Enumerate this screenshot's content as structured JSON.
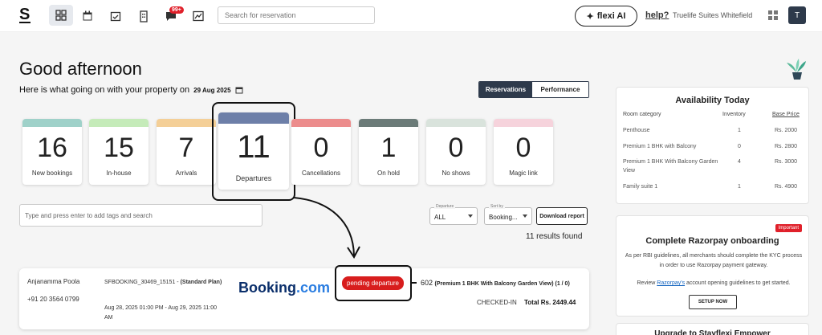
{
  "nav": {
    "logo": "S",
    "search_placeholder": "Search for reservation",
    "notification_count": "99+",
    "flexi_label": "flexi AI",
    "help_label": "help?",
    "property_name": "Truelife Suites Whitefield",
    "avatar_initial": "T"
  },
  "greeting": {
    "title": "Good afternoon",
    "subtitle": "Here is what going on with your property on",
    "date": "29 Aug 2025"
  },
  "view_toggle": {
    "active": "Reservations",
    "inactive": "Performance"
  },
  "stats": [
    {
      "value": "16",
      "label": "New bookings",
      "color": "#9fd1c9"
    },
    {
      "value": "15",
      "label": "In-house",
      "color": "#c5ebb9"
    },
    {
      "value": "7",
      "label": "Arrivals",
      "color": "#f4cf97"
    },
    {
      "value": "11",
      "label": "Departures",
      "color": "#6d7fa8"
    },
    {
      "value": "0",
      "label": "Cancellations",
      "color": "#ec8c8c"
    },
    {
      "value": "1",
      "label": "On hold",
      "color": "#6b7b78"
    },
    {
      "value": "0",
      "label": "No shows",
      "color": "#d9e3dc"
    },
    {
      "value": "0",
      "label": "Magic link",
      "color": "#f6d3dc"
    }
  ],
  "filters": {
    "tag_placeholder": "Type and press enter to add tags and search",
    "departure_caption": "Departure",
    "departure_value": "ALL",
    "sort_caption": "Sort by",
    "sort_value": "Booking...",
    "download_label": "Download report",
    "results_text": "11 results found"
  },
  "booking": {
    "guest_name": "Anjanamma Poola",
    "phone": "+91 20 3564 0799",
    "booking_id": "SFBOOKING_30469_15151 - ",
    "plan": "(Standard Plan)",
    "dates": "Aug 28, 2025 01:00 PM - Aug 29, 2025 11:00 AM",
    "source_main": "Booking",
    "source_suffix": ".com",
    "status_pill": "pending departure",
    "room_number": "602",
    "room_detail": "(Premium 1 BHK With Balcony Garden View)  (1 / 0)",
    "checkin_status": "CHECKED-IN",
    "total_label": "Total",
    "total_value": "Rs. 2449.44"
  },
  "availability": {
    "title": "Availability Today",
    "headers": {
      "category": "Room category",
      "inventory": "Inventory",
      "price": "Base Price"
    },
    "rows": [
      {
        "category": "Penthouse",
        "inventory": "1",
        "price": "Rs. 2000"
      },
      {
        "category": "Premium 1 BHK with Balcony",
        "inventory": "0",
        "price": "Rs. 2800"
      },
      {
        "category": "Premium 1 BHK With Balcony Garden View",
        "inventory": "4",
        "price": "Rs. 3000"
      },
      {
        "category": "Family suite 1",
        "inventory": "1",
        "price": "Rs. 4900"
      }
    ]
  },
  "razorpay": {
    "badge": "Important",
    "title": "Complete Razorpay onboarding",
    "body": "As per RBI guidelines, all merchants should complete the KYC process in order to use Razorpay payment gateway.",
    "review_prefix": "Review ",
    "review_link": "Razorpay's",
    "review_suffix": " account opening guidelines to get started.",
    "button": "SETUP NOW"
  },
  "upgrade": {
    "title": "Upgrade to Stayflexi Empower"
  }
}
